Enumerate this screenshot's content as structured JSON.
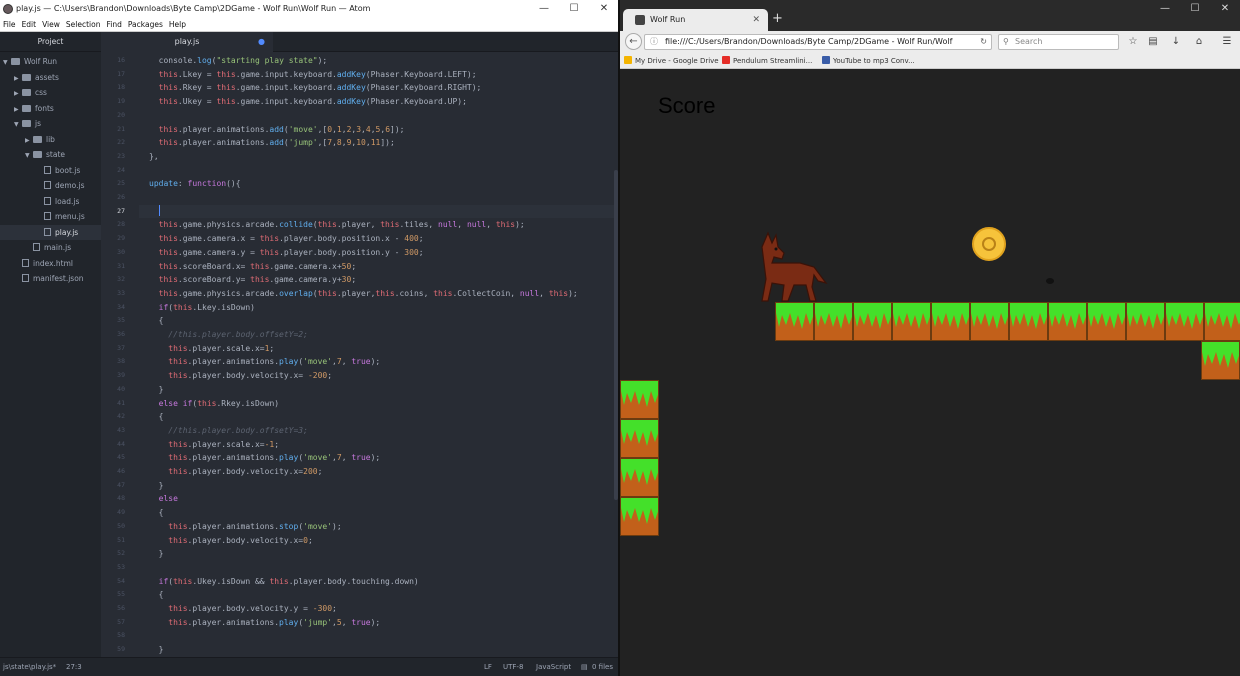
{
  "atom": {
    "title": "play.js — C:\\Users\\Brandon\\Downloads\\Byte Camp\\2DGame - Wolf Run\\Wolf Run — Atom",
    "menu": [
      "File",
      "Edit",
      "View",
      "Selection",
      "Find",
      "Packages",
      "Help"
    ],
    "sidebar": {
      "header": "Project",
      "tree": [
        {
          "label": "Wolf Run",
          "type": "folder",
          "open": true
        },
        {
          "label": "assets",
          "type": "folder"
        },
        {
          "label": "css",
          "type": "folder"
        },
        {
          "label": "fonts",
          "type": "folder"
        },
        {
          "label": "js",
          "type": "folder",
          "open": true
        },
        {
          "label": "lib",
          "type": "folder"
        },
        {
          "label": "state",
          "type": "folder",
          "open": true
        },
        {
          "label": "boot.js",
          "type": "file"
        },
        {
          "label": "demo.js",
          "type": "file"
        },
        {
          "label": "load.js",
          "type": "file"
        },
        {
          "label": "menu.js",
          "type": "file"
        },
        {
          "label": "play.js",
          "type": "file",
          "selected": true
        },
        {
          "label": "main.js",
          "type": "file"
        },
        {
          "label": "index.html",
          "type": "file"
        },
        {
          "label": "manifest.json",
          "type": "file"
        }
      ]
    },
    "tab": {
      "label": "play.js"
    },
    "line_numbers": [
      "16",
      "17",
      "18",
      "19",
      "20",
      "21",
      "22",
      "23",
      "24",
      "25",
      "26",
      "27",
      "28",
      "29",
      "30",
      "31",
      "32",
      "33",
      "34",
      "35",
      "36",
      "37",
      "38",
      "39",
      "40",
      "41",
      "42",
      "43",
      "44",
      "45",
      "46",
      "47",
      "48",
      "49",
      "50",
      "51",
      "52",
      "53",
      "54",
      "55",
      "56",
      "57",
      "58",
      "59"
    ],
    "code_lines": [
      "console.log(\"starting play state\");",
      "this.Lkey = this.game.input.keyboard.addKey(Phaser.Keyboard.LEFT);",
      "this.Rkey = this.game.input.keyboard.addKey(Phaser.Keyboard.RIGHT);",
      "this.Ukey = this.game.input.keyboard.addKey(Phaser.Keyboard.UP);",
      "",
      "this.player.animations.add('move',[0,1,2,3,4,5,6]);",
      "this.player.animations.add('jump',[7,8,9,10,11]);",
      "},",
      "",
      "update: function(){",
      "",
      "",
      "this.game.physics.arcade.collide(this.player, this.tiles, null, null, this);",
      "this.game.camera.x = this.player.body.position.x - 400;",
      "this.game.camera.y = this.player.body.position.y - 300;",
      "this.scoreBoard.x= this.game.camera.x+50;",
      "this.scoreBoard.y= this.game.camera.y+30;",
      "this.game.physics.arcade.overlap(this.player,this.coins, this.CollectCoin, null, this);",
      "if(this.Lkey.isDown)",
      "{",
      "//this.player.body.offsetY=2;",
      "this.player.scale.x=1;",
      "this.player.animations.play('move',7, true);",
      "this.player.body.velocity.x= -200;",
      "}",
      "else if(this.Rkey.isDown)",
      "{",
      "//this.player.body.offsetY=3;",
      "this.player.scale.x=-1;",
      "this.player.animations.play('move',7, true);",
      "this.player.body.velocity.x=200;",
      "}",
      "else",
      "{",
      "this.player.animations.stop('move');",
      "this.player.body.velocity.x=0;",
      "}",
      "",
      "if(this.Ukey.isDown && this.player.body.touching.down)",
      "{",
      "this.player.body.velocity.y = -300;",
      "this.player.animations.play('jump',5, true);",
      "",
      "}"
    ],
    "status": {
      "path": "js\\state\\play.js*",
      "cursor": "27:3",
      "line_ending": "LF",
      "encoding": "UTF-8",
      "grammar": "JavaScript",
      "files": "0 files"
    }
  },
  "browser": {
    "tab_title": "Wolf Run",
    "url": "file:///C:/Users/Brandon/Downloads/Byte Camp/2DGame - Wolf Run/Wolf",
    "search_placeholder": "Search",
    "bookmarks": [
      "My Drive - Google Drive",
      "Pendulum Streamlini...",
      "YouTube to mp3 Conv..."
    ],
    "game": {
      "score_label": "Score"
    }
  },
  "colors": {
    "grass": "#44e02a",
    "dirt": "#c2601a",
    "coin": "#f6c33b",
    "editor_bg": "#282c34"
  }
}
